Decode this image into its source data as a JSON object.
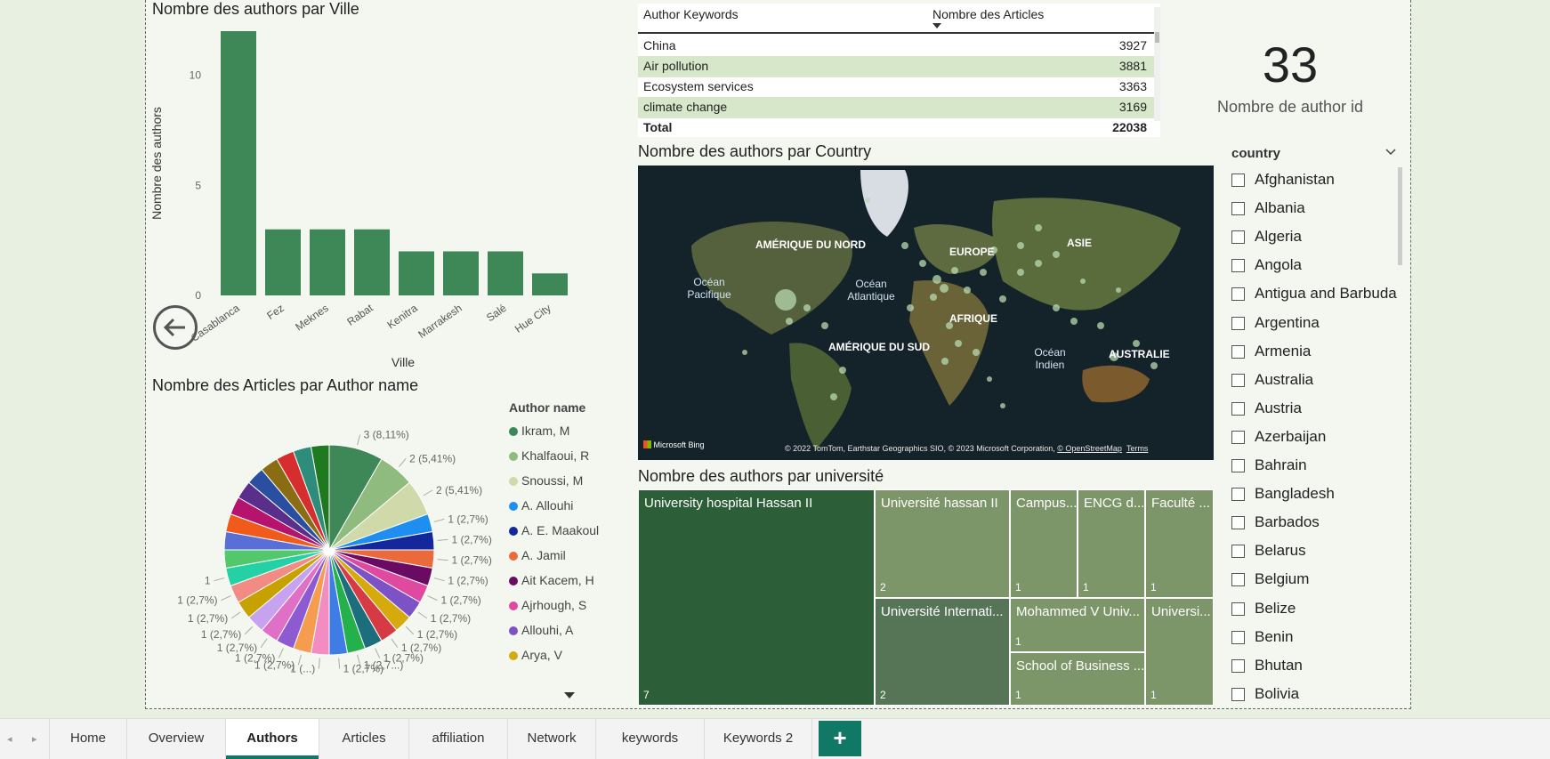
{
  "bar_panel": {
    "title": "Nombre des authors par Ville"
  },
  "pie_panel": {
    "title": "Nombre des Articles par Author name"
  },
  "map_panel": {
    "title": "Nombre des authors par Country",
    "labels": {
      "amerique_nord": "AMÉRIQUE DU NORD",
      "europe": "EUROPE",
      "asie": "ASIE",
      "ocean_pacifique_1": "Océan",
      "ocean_pacifique_2": "Pacifique",
      "ocean_atlantique_1": "Océan",
      "ocean_atlantique_2": "Atlantique",
      "afrique": "AFRIQUE",
      "amerique_sud": "AMÉRIQUE DU SUD",
      "ocean_indien_1": "Océan",
      "ocean_indien_2": "Indien",
      "australie": "AUSTRALIE"
    },
    "brand": "Microsoft Bing",
    "attribution": "© 2022 TomTom, Earthstar Geographics SIO, © 2023 Microsoft Corporation,",
    "osm_link": "© OpenStreetMap",
    "terms_link": "Terms"
  },
  "treemap_panel": {
    "title": "Nombre des authors par université",
    "cells": [
      {
        "name": "University hospital Hassan II",
        "count": "7",
        "color": "#2c5f37"
      },
      {
        "name": "Université hassan II",
        "count": "2",
        "color": "#7d9669"
      },
      {
        "name": "Campus...",
        "count": "1",
        "color": "#7d9669"
      },
      {
        "name": "ENCG d...",
        "count": "1",
        "color": "#7d9669"
      },
      {
        "name": "Faculté ...",
        "count": "1",
        "color": "#7d9669"
      },
      {
        "name": "Université Internati...",
        "count": "2",
        "color": "#557556"
      },
      {
        "name": "Mohammed V Univ...",
        "count": "1",
        "color": "#7d9669"
      },
      {
        "name": "Universi...",
        "count": "1",
        "color": "#7d9669"
      },
      {
        "name": "School of Business ...",
        "count": "1",
        "color": "#7d9669"
      }
    ]
  },
  "keywords_table": {
    "col_keyword": "Author Keywords",
    "col_articles": "Nombre des Articles",
    "rows": [
      {
        "keyword": "China",
        "articles": "3927"
      },
      {
        "keyword": "Air pollution",
        "articles": "3881"
      },
      {
        "keyword": "Ecosystem services",
        "articles": "3363"
      },
      {
        "keyword": "climate change",
        "articles": "3169"
      }
    ],
    "total_label": "Total",
    "total_value": "22038"
  },
  "card": {
    "value": "33",
    "label": "Nombre de author id"
  },
  "country_slicer": {
    "title": "country",
    "items": [
      "Afghanistan",
      "Albania",
      "Algeria",
      "Angola",
      "Antigua and Barbuda",
      "Argentina",
      "Armenia",
      "Australia",
      "Austria",
      "Azerbaijan",
      "Bahrain",
      "Bangladesh",
      "Barbados",
      "Belarus",
      "Belgium",
      "Belize",
      "Benin",
      "Bhutan",
      "Bolivia"
    ]
  },
  "tabs": [
    "Home",
    "Overview",
    "Authors",
    "Articles",
    "affiliation",
    "Network",
    "keywords",
    "Keywords 2"
  ],
  "add_tab": "+",
  "chart_data": [
    {
      "type": "bar",
      "title": "Nombre des authors par Ville",
      "xlabel": "Ville",
      "ylabel": "Nombre des authors",
      "categories": [
        "Casablanca",
        "Fez",
        "Meknes",
        "Rabat",
        "Kenitra",
        "Marrakesh",
        "Salé",
        "Hue City"
      ],
      "values": [
        12,
        3,
        3,
        3,
        2,
        2,
        2,
        1
      ],
      "ylim": [
        0,
        12
      ],
      "yticks": [
        0,
        5,
        10
      ],
      "color": "#3e8756"
    },
    {
      "type": "pie",
      "title": "Nombre des Articles par Author name",
      "legend_title": "Author name",
      "legend": [
        {
          "name": "Ikram, M",
          "color": "#3e8756"
        },
        {
          "name": "Khalfaoui, R",
          "color": "#8fbb7e"
        },
        {
          "name": "Snoussi, M",
          "color": "#cfd9a9"
        },
        {
          "name": "A. Allouhi",
          "color": "#1f8ef1"
        },
        {
          "name": "A. E. Maakoul",
          "color": "#14289e"
        },
        {
          "name": "A. Jamil",
          "color": "#ea6a3c"
        },
        {
          "name": "Ait Kacem, H",
          "color": "#6b0a63"
        },
        {
          "name": "Ajrhough, S",
          "color": "#e049a0"
        },
        {
          "name": "Allouhi, A",
          "color": "#7c52c4"
        },
        {
          "name": "Arya, V",
          "color": "#d6a90d"
        }
      ],
      "values": [
        3,
        2,
        2,
        1,
        1,
        1,
        1,
        1,
        1,
        1,
        1,
        1,
        1,
        1,
        1,
        1,
        1,
        1,
        1,
        1,
        1,
        1,
        1,
        1,
        1,
        1,
        1,
        1,
        1,
        1,
        1,
        1
      ],
      "colors": [
        "#3e8756",
        "#8fbb7e",
        "#cfd9a9",
        "#1f8ef1",
        "#14289e",
        "#ea6a3c",
        "#6b0a63",
        "#e049a0",
        "#7c52c4",
        "#d6a90d",
        "#d63a45",
        "#1c6e7c",
        "#24b04a",
        "#3f7de6",
        "#f28cc1",
        "#f59c4f",
        "#8e5ad1",
        "#e070c6",
        "#c7a2ee",
        "#c7a100",
        "#f28b84",
        "#23d1a5",
        "#52c76b",
        "#5a6fd6",
        "#f05a1a",
        "#b5136e",
        "#5a2f8b",
        "#2a4ea0",
        "#8a6d12",
        "#d62e2e",
        "#2d8c7a",
        "#1f7a1f"
      ],
      "data_labels": [
        "3 (8,11%)",
        "2 (5,41%)",
        "2 (5,41%)",
        "1 (2,7%)",
        "1 (2,7%)",
        "1 (2,7%)",
        "1 (2,7%)",
        "1 (2,7%)",
        "1 (2,7%)",
        "1 (2,7%)",
        "1 (2,7%)",
        "1 (2,7%)",
        "1 (2,7...)",
        "1 (2,7%)",
        "1 (...)",
        "1 (2,7%)",
        "1 (2,7%)",
        "1 (2,7%)",
        "1 (2,7%)",
        "1 (2,7%)",
        "1 (2,7%)",
        "1"
      ]
    }
  ]
}
